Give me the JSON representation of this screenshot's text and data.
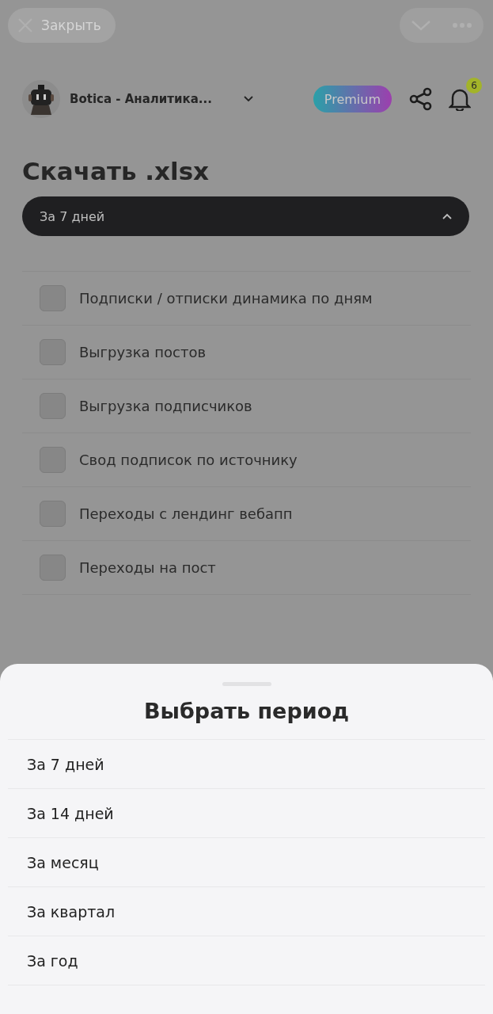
{
  "top_bar": {
    "close_label": "Закрыть"
  },
  "header": {
    "channel_name": "Botica - Аналитика...",
    "badge": "Premium",
    "notification_count": "6"
  },
  "title": "Скачать .xlsx",
  "period_select": {
    "value": "За 7 дней",
    "expanded": true
  },
  "reports": [
    {
      "label": "Подписки / отписки динамика по дням",
      "checked": false
    },
    {
      "label": "Выгрузка постов",
      "checked": false
    },
    {
      "label": "Выгрузка подписчиков",
      "checked": false
    },
    {
      "label": "Свод подписок по источнику",
      "checked": false
    },
    {
      "label": "Переходы с лендинг вебапп",
      "checked": false
    },
    {
      "label": "Переходы на пост",
      "checked": false
    }
  ],
  "sheet": {
    "title": "Выбрать период",
    "options": [
      {
        "label": "За 7 дней"
      },
      {
        "label": "За 14 дней"
      },
      {
        "label": "За месяц"
      },
      {
        "label": "За квартал"
      },
      {
        "label": "За год"
      }
    ]
  }
}
